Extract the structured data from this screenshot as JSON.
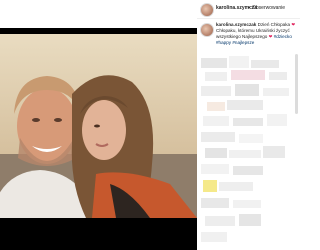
{
  "post": {
    "username": "karolina.szymcza",
    "separator": "•",
    "follow_label": "Obserwowanie",
    "caption_user": "karolina.szymczak",
    "caption_text": "Dzień Chłopaka ",
    "caption_rest": " Chłopaku, któremu Ukraiński życzyć wszystkiego Najlepszego ",
    "caption_hashtags": "#dziecko #happy #najlepsze",
    "heart_glyph": "❤"
  },
  "colors": {
    "accent_heart": "#e0245e",
    "hashtag": "#003569",
    "text": "#262626"
  }
}
